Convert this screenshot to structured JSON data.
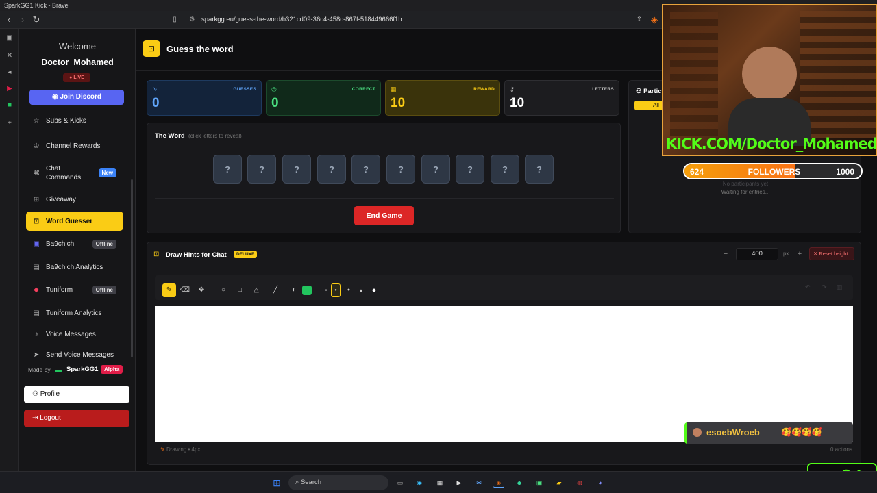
{
  "window": {
    "title": "SparkGG1 Kick - Brave"
  },
  "browser": {
    "url": "sparkgg.eu/guess-the-word/b321cd09-36c4-458c-867f-518449666f1b"
  },
  "sidebar": {
    "welcome": "Welcome",
    "username": "Doctor_Mohamed",
    "live_badge": "LIVE",
    "join_discord": "Join Discord",
    "items": [
      {
        "label": "Subs & Kicks",
        "icon": "star-icon"
      },
      {
        "label": "Channel Rewards",
        "icon": "award-icon"
      },
      {
        "label": "Chat Commands",
        "icon": "command-icon",
        "badge": "New"
      },
      {
        "label": "Giveaway",
        "icon": "gift-icon"
      },
      {
        "label": "Word Guesser",
        "icon": "gamepad-icon",
        "active": true
      },
      {
        "label": "Ba9chich",
        "icon": "ba9chich-logo",
        "badge": "Offline"
      },
      {
        "label": "Ba9chich Analytics",
        "icon": "chart-icon"
      },
      {
        "label": "Tuniform",
        "icon": "tuniform-logo",
        "badge": "Offline"
      },
      {
        "label": "Tuniform Analytics",
        "icon": "chart-icon"
      },
      {
        "label": "Voice Messages",
        "icon": "mic-icon"
      },
      {
        "label": "Send Voice Messages",
        "icon": "send-icon"
      }
    ],
    "made_by": "Made by",
    "brand": "SparkGG1",
    "alpha": "Alpha",
    "profile": "Profile",
    "logout": "Logout"
  },
  "header": {
    "title": "Guess the word"
  },
  "stats": [
    {
      "label": "GUESSES",
      "value": "0",
      "color": "#3b82f6"
    },
    {
      "label": "CORRECT",
      "value": "0",
      "color": "#22c55e"
    },
    {
      "label": "REWARD",
      "value": "10",
      "color": "#eab308"
    },
    {
      "label": "LETTERS",
      "value": "10",
      "color": "#9ca3af"
    }
  ],
  "word": {
    "title": "The Word",
    "hint": "(click letters to reveal)",
    "tiles": [
      "?",
      "?",
      "?",
      "?",
      "?",
      "?",
      "?",
      "?",
      "?",
      "?"
    ],
    "end_game": "End Game"
  },
  "participants": {
    "title": "Partic",
    "filter": "All",
    "empty": "No participants yet",
    "waiting": "Waiting for entries..."
  },
  "draw": {
    "title": "Draw Hints for Chat",
    "tag": "DELUXE",
    "height_value": "400",
    "height_unit": "px",
    "reset_height": "Reset height",
    "status": "Drawing • 4px",
    "actions": "0 actions",
    "current_color": "#22c55e"
  },
  "overlay": {
    "cam_text": "KICK.COM/Doctor_Mohamed",
    "followers_current": "624",
    "followers_label": "FOLLOWERS",
    "followers_goal": "1000",
    "followers_progress": 0.624,
    "chat_user": "esoebWroeb",
    "chat_emotes": "🥰🥰🥰🥰",
    "k_badge": "K",
    "k_number": "24"
  },
  "taskbar": {
    "search": "Search"
  }
}
